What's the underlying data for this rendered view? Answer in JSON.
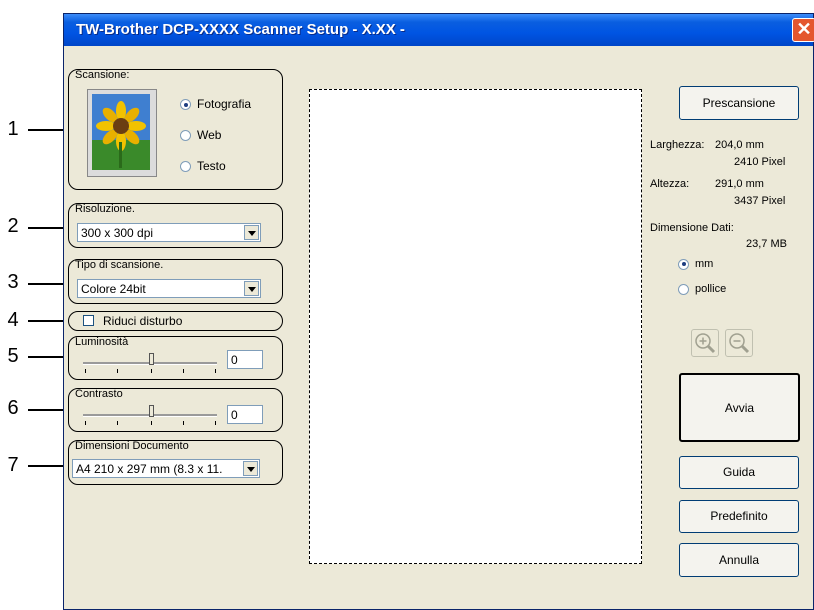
{
  "window": {
    "title": "TW-Brother DCP-XXXX Scanner Setup - X.XX -",
    "close_glyph": "✕"
  },
  "callouts": [
    "1",
    "2",
    "3",
    "4",
    "5",
    "6",
    "7"
  ],
  "scan": {
    "label": "Scansione:",
    "options": [
      {
        "label": "Fotografia",
        "selected": true
      },
      {
        "label": "Web",
        "selected": false
      },
      {
        "label": "Testo",
        "selected": false
      }
    ]
  },
  "resolution": {
    "label": "Risoluzione.",
    "value": "300 x 300 dpi"
  },
  "scan_type": {
    "label": "Tipo di scansione.",
    "value": "Colore 24bit"
  },
  "noise": {
    "label": "Riduci disturbo",
    "checked": false
  },
  "brightness": {
    "label": "Luminosità",
    "value": "0",
    "level": 0
  },
  "contrast": {
    "label": "Contrasto",
    "value": "0",
    "level": 0
  },
  "doc_size": {
    "label": "Dimensioni Documento",
    "value": "A4 210 x 297 mm (8.3 x 11."
  },
  "buttons": {
    "prescan": "Prescansione",
    "start": "Avvia",
    "help": "Guida",
    "default": "Predefinito",
    "cancel": "Annulla"
  },
  "info": {
    "width_label": "Larghezza:",
    "width_mm": "204,0 mm",
    "width_px": "2410 Pixel",
    "height_label": "Altezza:",
    "height_mm": "291,0 mm",
    "height_px": "3437 Pixel",
    "data_label": "Dimensione Dati:",
    "data_value": "23,7 MB"
  },
  "units": [
    {
      "label": "mm",
      "selected": true
    },
    {
      "label": "pollice",
      "selected": false
    }
  ],
  "icons": [
    "zoom-in-icon",
    "zoom-out-icon",
    "sunflower-photo-icon"
  ]
}
